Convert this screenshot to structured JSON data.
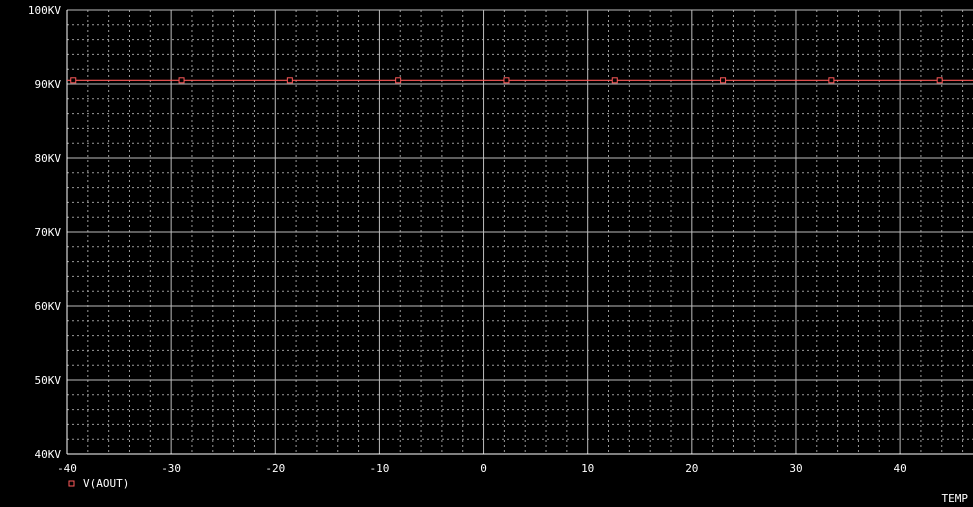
{
  "chart_data": {
    "type": "line",
    "xlabel": "TEMP",
    "ylabel": "",
    "xlim": [
      -40,
      47
    ],
    "ylim": [
      40,
      100
    ],
    "x_ticks": [
      -40,
      -30,
      -20,
      -10,
      0,
      10,
      20,
      30,
      40
    ],
    "x_tick_labels": [
      "-40",
      "-30",
      "-20",
      "-10",
      "0",
      "10",
      "20",
      "30",
      "40"
    ],
    "y_ticks": [
      40,
      50,
      60,
      70,
      80,
      90,
      100
    ],
    "y_tick_labels": [
      "40KV",
      "50KV",
      "60KV",
      "70KV",
      "80KV",
      "90KV",
      "100KV"
    ],
    "grid": true,
    "legend_position": "bottom-left",
    "series": [
      {
        "name": "V(AOUT)",
        "color": "#ff5a5a",
        "marker": "square",
        "x": [
          -40,
          -30,
          -20,
          -10,
          0,
          10,
          20,
          30,
          40,
          47
        ],
        "y": [
          90.5,
          90.5,
          90.5,
          90.5,
          90.5,
          90.5,
          90.5,
          90.5,
          90.5,
          90.5
        ],
        "marker_x": [
          -39.4,
          -29,
          -18.6,
          -8.2,
          2.2,
          12.6,
          23,
          33.4,
          43.8
        ]
      }
    ]
  }
}
